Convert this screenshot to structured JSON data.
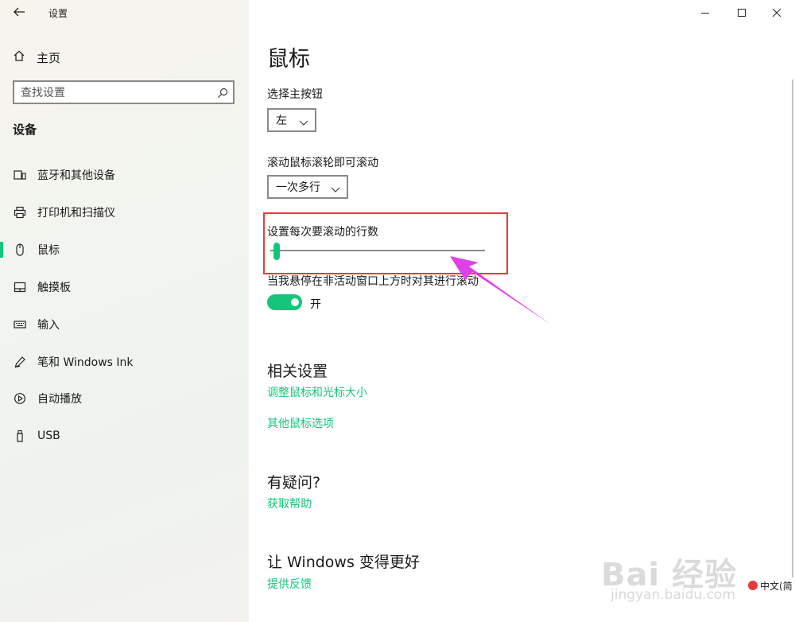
{
  "window": {
    "title": "设置"
  },
  "sidebar": {
    "home_label": "主页",
    "search": {
      "placeholder": "查找设置",
      "value": ""
    },
    "section_title": "设备",
    "items": [
      {
        "label": "蓝牙和其他设备",
        "icon": "bluetooth-devices-icon"
      },
      {
        "label": "打印机和扫描仪",
        "icon": "printer-icon"
      },
      {
        "label": "鼠标",
        "icon": "mouse-icon",
        "active": true
      },
      {
        "label": "触摸板",
        "icon": "touchpad-icon"
      },
      {
        "label": "输入",
        "icon": "keyboard-icon"
      },
      {
        "label": "笔和 Windows Ink",
        "icon": "pen-icon"
      },
      {
        "label": "自动播放",
        "icon": "autoplay-icon"
      },
      {
        "label": "USB",
        "icon": "usb-icon"
      }
    ]
  },
  "main": {
    "title": "鼠标",
    "primary_button": {
      "label": "选择主按钮",
      "value": "左"
    },
    "wheel_scroll": {
      "label": "滚动鼠标滚轮即可滚动",
      "value": "一次多行"
    },
    "lines_slider": {
      "label": "设置每次要滚动的行数",
      "value_fraction": 0.03
    },
    "inactive_scroll": {
      "label": "当我悬停在非活动窗口上方时对其进行滚动",
      "state": "开",
      "on": true
    },
    "related": {
      "title": "相关设置",
      "links": [
        "调整鼠标和光标大小",
        "其他鼠标选项"
      ]
    },
    "questions": {
      "title": "有疑问?",
      "link": "获取帮助"
    },
    "feedback": {
      "title": "让 Windows 变得更好",
      "link": "提供反馈"
    }
  },
  "overlay": {
    "highlight_color": "#e53b3b",
    "arrow_color": "#e040e8",
    "watermark": {
      "logo": "Bai 经验",
      "url": "jingyan.baidu.com"
    },
    "ime_label": "中文(简"
  },
  "colors": {
    "accent": "#13c67a"
  }
}
